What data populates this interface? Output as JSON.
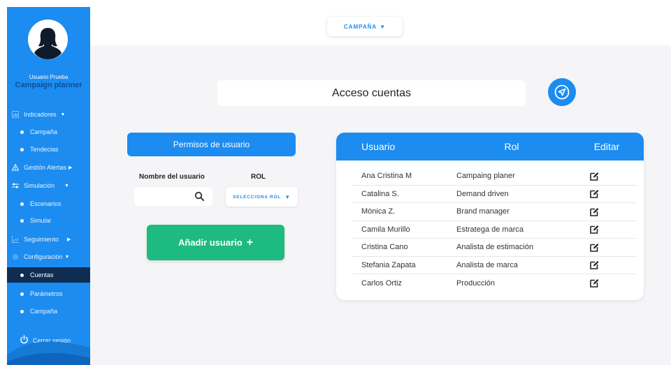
{
  "sidebar": {
    "user_name": "Usuario Prueba",
    "app_name": "Campaign planner",
    "items": [
      {
        "label": "Indicadores",
        "icon": "chart-icon",
        "type": "group",
        "caret": "▼"
      },
      {
        "label": "Campaña",
        "type": "sub"
      },
      {
        "label": "Tendecias",
        "type": "sub"
      },
      {
        "label": "Gestión Alertas",
        "icon": "warning-icon",
        "type": "group",
        "caret": "▶"
      },
      {
        "label": "Simulación",
        "icon": "sliders-icon",
        "type": "group",
        "caret": "▼"
      },
      {
        "label": "Escenarios",
        "type": "sub"
      },
      {
        "label": "Simular",
        "type": "sub"
      },
      {
        "label": "Seguimiento",
        "icon": "trend-icon",
        "type": "group",
        "caret": "▶"
      },
      {
        "label": "Configuración",
        "icon": "gear-icon",
        "type": "group",
        "caret": "▼"
      },
      {
        "label": "Cuentas",
        "type": "sub",
        "active": true
      },
      {
        "label": "Parámetros",
        "type": "sub"
      },
      {
        "label": "Campaña",
        "type": "sub"
      }
    ],
    "logout_label": "Cerrar sesión"
  },
  "topbar": {
    "campaign_label": "CAMPAÑA",
    "caret": "▼"
  },
  "main": {
    "page_title": "Acceso cuentas",
    "permissions_header": "Permisos de usuario",
    "username_label": "Nombre del usuario",
    "role_label": "ROL",
    "username_value": "",
    "role_select_label": "SELECCIONA ROL",
    "role_caret": "▼",
    "add_user_label": "Añadir usuario",
    "add_user_plus": "+"
  },
  "users_table": {
    "headers": {
      "user": "Usuario",
      "role": "Rol",
      "edit": "Editar"
    },
    "rows": [
      {
        "user": "Ana Cristina M",
        "role": "Campaing planer"
      },
      {
        "user": "Catalina S.",
        "role": "Demand driven"
      },
      {
        "user": "Mónica Z.",
        "role": "Brand manager"
      },
      {
        "user": "Camila Murillo",
        "role": "Estratega de marca"
      },
      {
        "user": "Cristina Cano",
        "role": "Analista de estimación"
      },
      {
        "user": "Stefania Zapata",
        "role": "Analista de marca"
      },
      {
        "user": "Carlos Ortiz",
        "role": "Producción"
      }
    ]
  },
  "colors": {
    "primary": "#1c8cf0",
    "success": "#1dba82",
    "sidebar_active": "#0d2d52",
    "background": "#f5f5f7"
  }
}
